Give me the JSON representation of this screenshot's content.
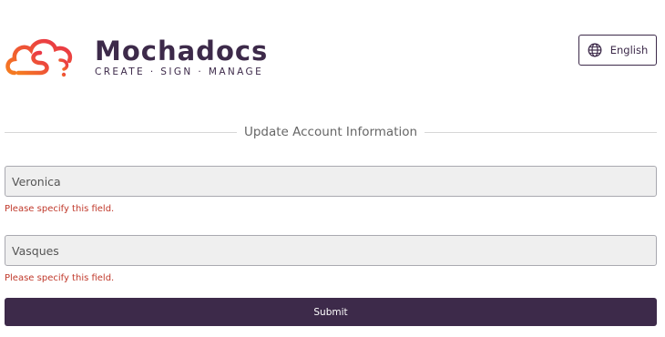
{
  "brand": {
    "name": "Mochadocs",
    "tagline": "CREATE · SIGN · MANAGE",
    "colors": {
      "primary": "#3d2a4a",
      "logo_gradient_start": "#e8304a",
      "logo_gradient_end": "#f57c20"
    }
  },
  "language_selector": {
    "label": "English",
    "icon": "globe-icon"
  },
  "form": {
    "title": "Update Account Information",
    "fields": [
      {
        "value": "Veronica",
        "error": "Please specify this field."
      },
      {
        "value": "Vasques",
        "error": "Please specify this field."
      }
    ],
    "submit_label": "Submit"
  },
  "colors": {
    "error_text": "#c0392b",
    "field_background": "#efefef",
    "divider": "#d6d6d6"
  }
}
